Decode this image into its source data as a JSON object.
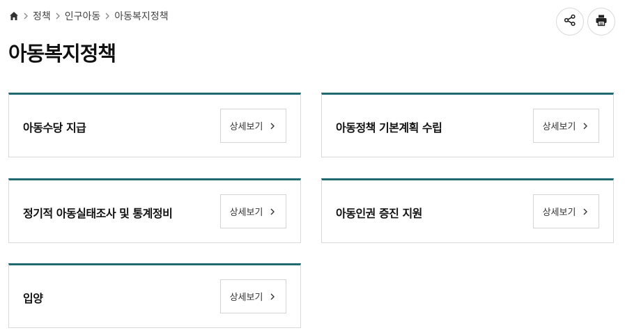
{
  "breadcrumb": {
    "home_icon": "home-icon",
    "items": [
      "정책",
      "인구아동",
      "아동복지정책"
    ]
  },
  "header": {
    "share_icon": "share-icon",
    "print_icon": "printer-icon"
  },
  "page_title": "아동복지정책",
  "cards": [
    {
      "title": "아동수당 지급",
      "button_label": "상세보기"
    },
    {
      "title": "아동정책 기본계획 수립",
      "button_label": "상세보기"
    },
    {
      "title": "정기적 아동실태조사 및 통계정비",
      "button_label": "상세보기"
    },
    {
      "title": "아동인권 증진 지원",
      "button_label": "상세보기"
    },
    {
      "title": "입양",
      "button_label": "상세보기"
    }
  ],
  "colors": {
    "accent": "#1f6a70",
    "border": "#d9d9d9"
  }
}
